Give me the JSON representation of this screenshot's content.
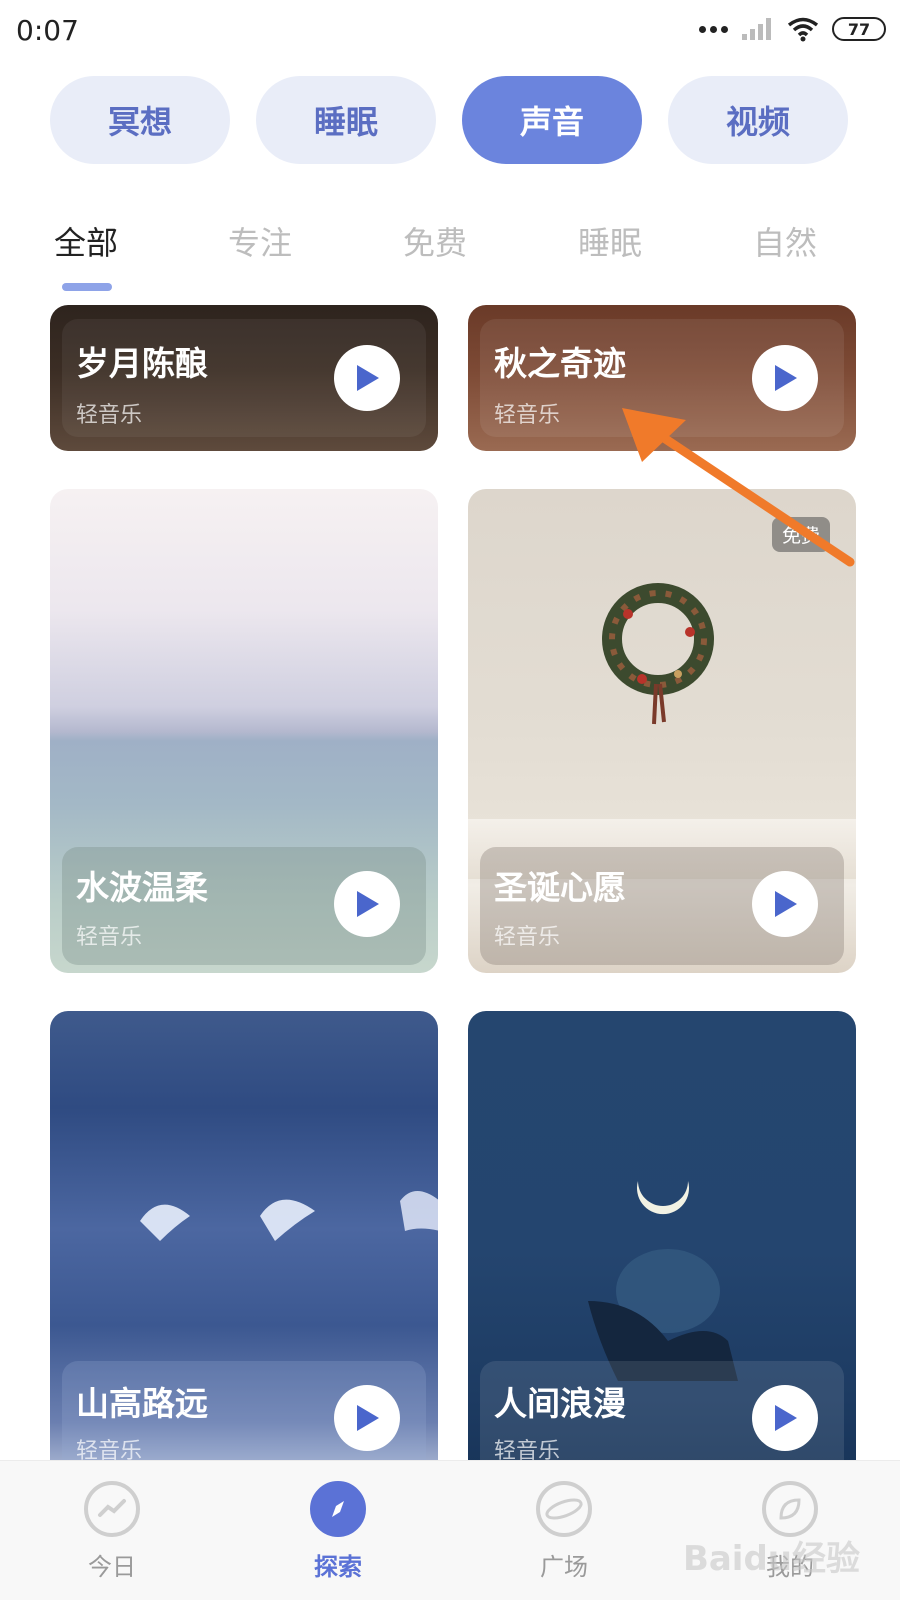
{
  "status_bar": {
    "time": "0:07",
    "battery": "77"
  },
  "segments": [
    {
      "label": "冥想",
      "active": false
    },
    {
      "label": "睡眠",
      "active": false
    },
    {
      "label": "声音",
      "active": true
    },
    {
      "label": "视频",
      "active": false
    }
  ],
  "filter_tabs": [
    {
      "label": "全部",
      "active": true
    },
    {
      "label": "专注",
      "active": false
    },
    {
      "label": "免费",
      "active": false
    },
    {
      "label": "睡眠",
      "active": false
    },
    {
      "label": "自然",
      "active": false
    }
  ],
  "cards": [
    {
      "title": "岁月陈酿",
      "subtitle": "轻音乐"
    },
    {
      "title": "秋之奇迹",
      "subtitle": "轻音乐"
    },
    {
      "title": "水波温柔",
      "subtitle": "轻音乐"
    },
    {
      "title": "圣诞心愿",
      "subtitle": "轻音乐",
      "badge": "免费"
    },
    {
      "title": "山高路远",
      "subtitle": "轻音乐"
    },
    {
      "title": "人间浪漫",
      "subtitle": "轻音乐"
    }
  ],
  "bottom_nav": [
    {
      "label": "今日",
      "icon": "trend-icon",
      "active": false
    },
    {
      "label": "探索",
      "icon": "compass-icon",
      "active": true
    },
    {
      "label": "广场",
      "icon": "planet-icon",
      "active": false
    },
    {
      "label": "我的",
      "icon": "leaf-icon",
      "active": false
    }
  ],
  "colors": {
    "accent": "#6b84dd",
    "pill_bg": "#e9edf8",
    "annotation_arrow": "#f07a2a"
  },
  "watermark": "Baidu经验"
}
